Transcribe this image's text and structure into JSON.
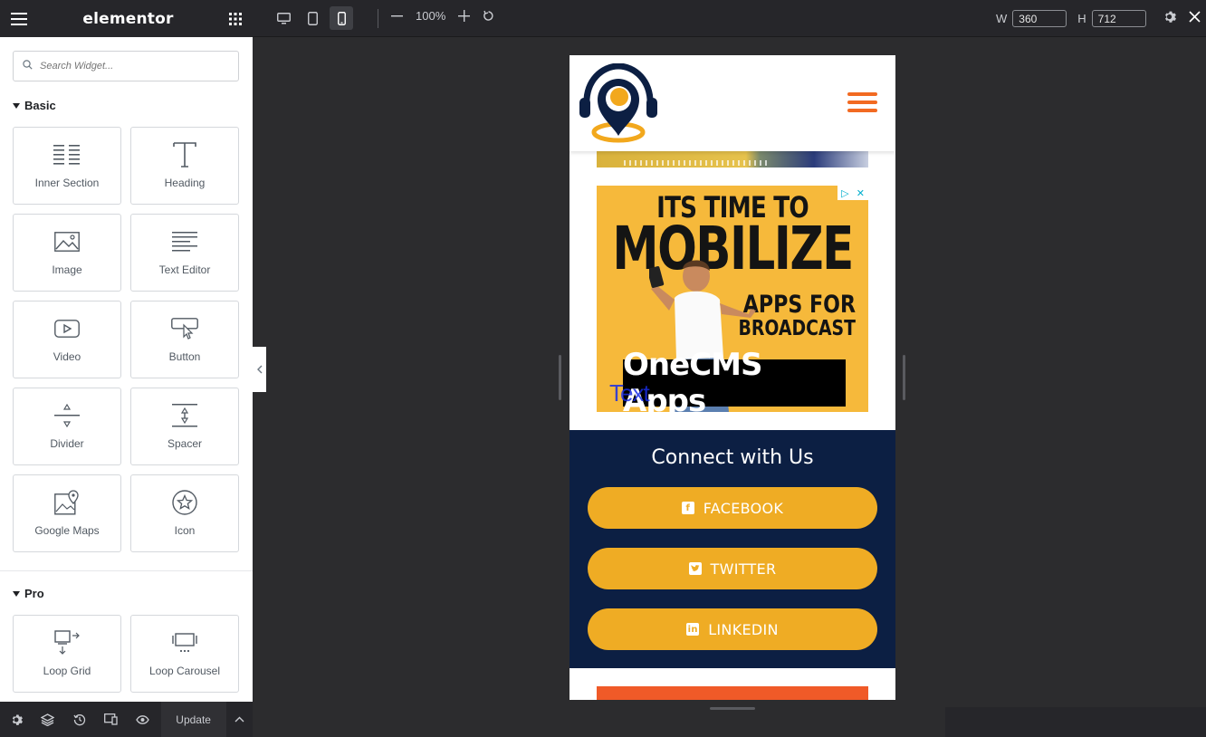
{
  "app": {
    "brand": "elementor"
  },
  "toolbar": {
    "zoom": "100%",
    "width_label": "W",
    "width_value": "360",
    "height_label": "H",
    "height_value": "712"
  },
  "panel": {
    "search_placeholder": "Search Widget...",
    "categories": [
      {
        "name": "Basic",
        "widgets": [
          {
            "label": "Inner Section",
            "icon": "inner-section-icon"
          },
          {
            "label": "Heading",
            "icon": "heading-icon"
          },
          {
            "label": "Image",
            "icon": "image-icon"
          },
          {
            "label": "Text Editor",
            "icon": "text-editor-icon"
          },
          {
            "label": "Video",
            "icon": "video-icon"
          },
          {
            "label": "Button",
            "icon": "button-icon"
          },
          {
            "label": "Divider",
            "icon": "divider-icon"
          },
          {
            "label": "Spacer",
            "icon": "spacer-icon"
          },
          {
            "label": "Google Maps",
            "icon": "google-maps-icon"
          },
          {
            "label": "Icon",
            "icon": "star-icon"
          }
        ]
      },
      {
        "name": "Pro",
        "widgets": [
          {
            "label": "Loop Grid",
            "icon": "loop-grid-icon"
          },
          {
            "label": "Loop Carousel",
            "icon": "loop-carousel-icon"
          }
        ]
      }
    ]
  },
  "bottombar": {
    "update_label": "Update"
  },
  "preview": {
    "ad": {
      "line1": "ITS TIME TO",
      "line2": "MOBILIZE",
      "line3": "APPS FOR",
      "line4": "BROADCAST",
      "logo": "OneCMS Apps",
      "overlay_text": "Text"
    },
    "connect": {
      "title": "Connect with Us",
      "buttons": [
        {
          "label": "FACEBOOK",
          "icon": "facebook-icon"
        },
        {
          "label": "TWITTER",
          "icon": "twitter-icon"
        },
        {
          "label": "LINKEDIN",
          "icon": "linkedin-icon"
        }
      ]
    }
  },
  "colors": {
    "accent_orange": "#f26a22",
    "button_gold": "#efac24",
    "connect_bg": "#0c1f43",
    "ad_bg": "#f6b93b",
    "editor_dark": "#26262a"
  }
}
